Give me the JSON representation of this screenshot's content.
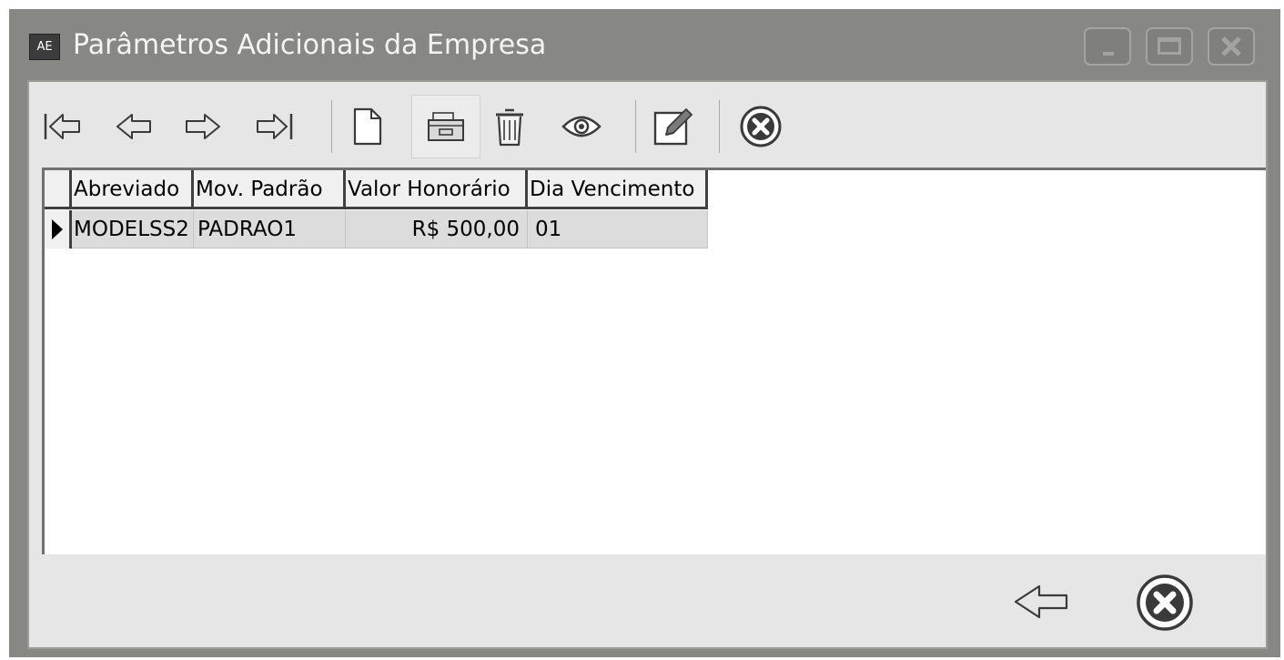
{
  "window": {
    "icon_text": "AE",
    "title": "Parâmetros Adicionais da Empresa",
    "controls": [
      "minimize-icon",
      "maximize-icon",
      "close-icon"
    ]
  },
  "toolbar": {
    "buttons": [
      {
        "name": "first-record",
        "icon": "arrow-first-icon"
      },
      {
        "name": "previous-record",
        "icon": "arrow-left-icon"
      },
      {
        "name": "next-record",
        "icon": "arrow-right-icon"
      },
      {
        "name": "last-record",
        "icon": "arrow-last-icon"
      },
      {
        "name": "new-record",
        "icon": "new-document-icon"
      },
      {
        "name": "open-record",
        "icon": "open-folder-icon"
      },
      {
        "name": "delete-record",
        "icon": "trash-icon"
      },
      {
        "name": "view-record",
        "icon": "eye-icon"
      },
      {
        "name": "edit-record",
        "icon": "edit-icon"
      },
      {
        "name": "cancel",
        "icon": "cancel-circle-icon"
      }
    ]
  },
  "grid": {
    "columns": [
      "Abreviado",
      "Mov. Padrão",
      "Valor Honorário",
      "Dia Vencimento"
    ],
    "rows": [
      [
        "MODELSS2",
        "PADRAO1",
        "R$ 500,00",
        "01"
      ]
    ]
  },
  "footer": {
    "buttons": [
      {
        "name": "back",
        "icon": "arrow-left-icon"
      },
      {
        "name": "close",
        "icon": "cancel-circle-icon"
      }
    ]
  },
  "colors": {
    "titlebar": "#878784",
    "client": "#e6e6e6",
    "grid_row": "#dcdcdc"
  }
}
